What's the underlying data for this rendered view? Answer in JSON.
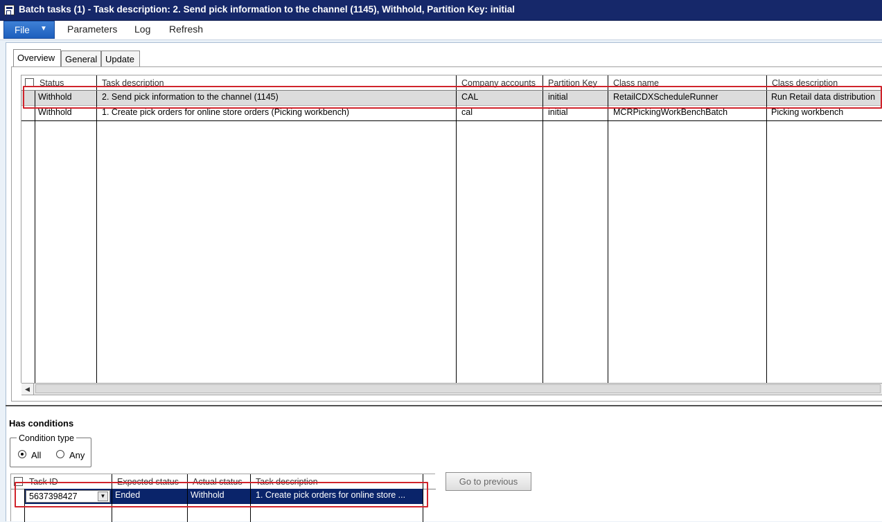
{
  "window": {
    "title": "Batch tasks (1) - Task description: 2. Send pick information to the channel (1145), Withhold, Partition Key: initial"
  },
  "menu": {
    "file_label": "File",
    "items": [
      "Parameters",
      "Log",
      "Refresh"
    ]
  },
  "tabs": [
    "Overview",
    "General",
    "Update"
  ],
  "tasks_grid": {
    "columns": [
      "Status",
      "Task description",
      "Company accounts",
      "Partition Key",
      "Class name",
      "Class description"
    ],
    "rows": [
      [
        "Withhold",
        "2. Send pick information to the channel (1145)",
        "CAL",
        "initial",
        "RetailCDXScheduleRunner",
        "Run Retail data distribution"
      ],
      [
        "Withhold",
        "1. Create pick orders for online store orders (Picking workbench)",
        "cal",
        "initial",
        "MCRPickingWorkBenchBatch",
        "Picking workbench"
      ]
    ]
  },
  "conditions": {
    "section_title": "Has conditions",
    "condition_type_label": "Condition type",
    "options": [
      "All",
      "Any"
    ],
    "selected": "All",
    "columns": [
      "Task ID",
      "Expected status",
      "Actual status",
      "Task description"
    ],
    "rows": [
      [
        "5637398427",
        "Ended",
        "Withhold",
        "1. Create pick orders for online store ..."
      ]
    ],
    "go_previous_label": "Go to previous"
  },
  "colors": {
    "title_bar": "#16286a",
    "file_button": "#2a6dc9",
    "selected_row": "#0a246a",
    "highlight_box": "#d0232b"
  }
}
